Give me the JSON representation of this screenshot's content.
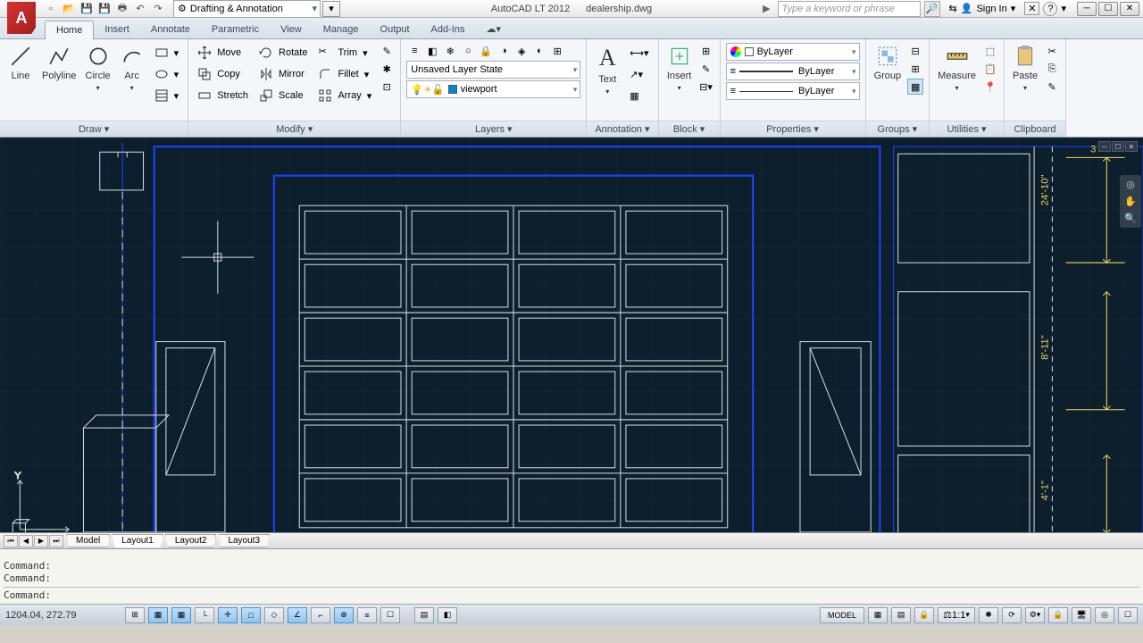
{
  "app": {
    "logo_letter": "A",
    "name": "AutoCAD LT 2012",
    "file": "dealership.dwg",
    "workspace": "Drafting & Annotation"
  },
  "search": {
    "placeholder": "Type a keyword or phrase"
  },
  "user": {
    "signin": "Sign In"
  },
  "tabs": [
    "Home",
    "Insert",
    "Annotate",
    "Parametric",
    "View",
    "Manage",
    "Output",
    "Add-Ins"
  ],
  "active_tab": "Home",
  "panels": {
    "draw": {
      "title": "Draw ▾",
      "items": [
        "Line",
        "Polyline",
        "Circle",
        "Arc"
      ]
    },
    "modify": {
      "title": "Modify ▾",
      "move": "Move",
      "copy": "Copy",
      "stretch": "Stretch",
      "rotate": "Rotate",
      "mirror": "Mirror",
      "scale": "Scale",
      "trim": "Trim",
      "fillet": "Fillet",
      "array": "Array"
    },
    "layers": {
      "title": "Layers ▾",
      "state": "Unsaved Layer State",
      "current": "viewport"
    },
    "annotation": {
      "title": "Annotation ▾",
      "text": "Text"
    },
    "block": {
      "title": "Block ▾",
      "insert": "Insert"
    },
    "properties": {
      "title": "Properties ▾",
      "color": "ByLayer",
      "ltype": "ByLayer",
      "lweight": "ByLayer"
    },
    "groups": {
      "title": "Groups ▾",
      "group": "Group"
    },
    "utilities": {
      "title": "Utilities ▾",
      "measure": "Measure"
    },
    "clipboard": {
      "title": "Clipboard",
      "paste": "Paste"
    }
  },
  "layout_tabs": {
    "model": "Model",
    "tabs": [
      "Layout1",
      "Layout2",
      "Layout3"
    ],
    "active": "Layout1"
  },
  "commands": [
    "Command:",
    "Command:",
    "Command:"
  ],
  "status": {
    "coords": "1204.04, 272.79",
    "model": "MODEL",
    "scale": "1:1"
  },
  "dims": {
    "d1": "24'-10\"",
    "d2": "8'-11\"",
    "d3": "4'-1\"",
    "corner": "3"
  }
}
